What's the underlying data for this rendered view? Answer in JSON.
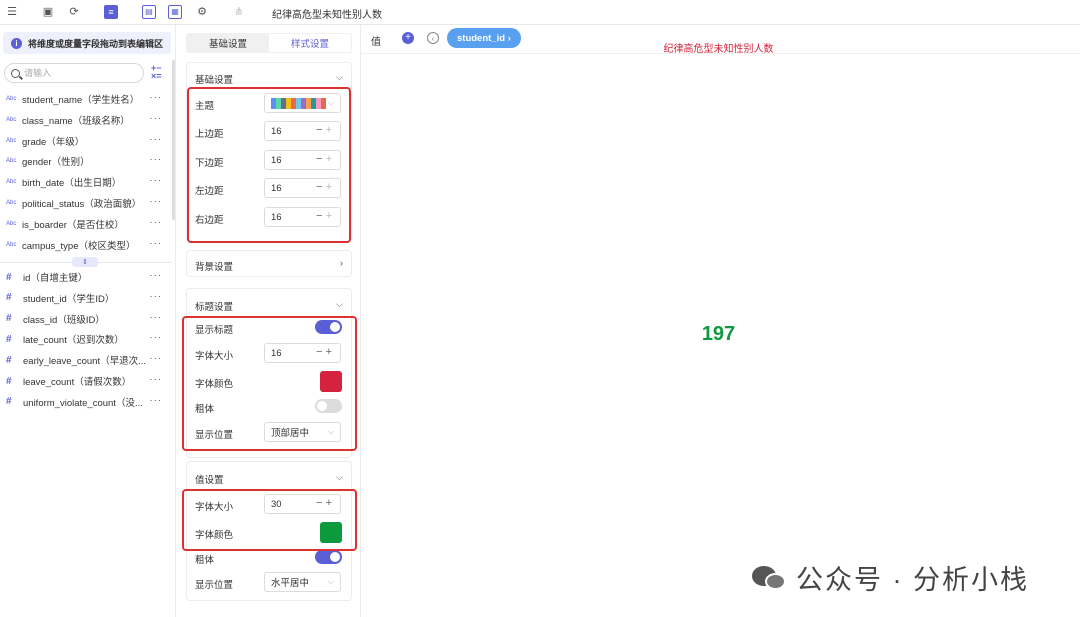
{
  "toolbar": {
    "title": "纪律高危型未知性别人数",
    "icons": [
      "menu-icon",
      "save-icon",
      "refresh-icon",
      "dataset-icon",
      "chart-config-icon",
      "layout-icon",
      "settings-icon",
      "share-icon"
    ]
  },
  "left_panel": {
    "hint": "将维度或度量字段拖动到表编辑区",
    "search_placeholder": "请输入",
    "dimension_type_label": "Abc",
    "measure_type_label": "#",
    "dimensions": [
      "student_name（学生姓名）",
      "class_name（班级名称）",
      "grade（年级）",
      "gender（性别）",
      "birth_date（出生日期）",
      "political_status（政治面貌）",
      "is_boarder（是否住校）",
      "campus_type（校区类型）"
    ],
    "measures": [
      "id（自增主键）",
      "student_id（学生ID）",
      "class_id（班级ID）",
      "late_count（迟到次数）",
      "early_leave_count（早退次...",
      "leave_count（请假次数）",
      "uniform_violate_count（没..."
    ],
    "more_label": "···"
  },
  "config": {
    "tabs": [
      "基础设置",
      "样式设置"
    ],
    "active_tab": 1,
    "basic": {
      "header": "基础设置",
      "theme_label": "主题",
      "theme_colors": [
        "#5b8ff9",
        "#5ad8a6",
        "#5d7092",
        "#f6bd16",
        "#e8684a",
        "#6dc8ec",
        "#9270ca",
        "#ff9d4d",
        "#269a99",
        "#ff99c3",
        "#e8684a"
      ],
      "margin_top_label": "上边距",
      "margin_top": "16",
      "margin_bottom_label": "下边距",
      "margin_bottom": "16",
      "margin_left_label": "左边距",
      "margin_left": "16",
      "margin_right_label": "右边距",
      "margin_right": "16"
    },
    "background": {
      "header": "背景设置"
    },
    "title": {
      "header": "标题设置",
      "show_title_label": "显示标题",
      "show_title": true,
      "font_size_label": "字体大小",
      "font_size": "16",
      "font_color_label": "字体颜色",
      "font_color": "#d6233d",
      "bold_label": "粗体",
      "bold": false,
      "position_label": "显示位置",
      "position": "顶部居中"
    },
    "value": {
      "header": "值设置",
      "font_size_label": "字体大小",
      "font_size": "30",
      "font_color_label": "字体颜色",
      "font_color": "#0d9a3f",
      "bold_label": "粗体",
      "bold": true,
      "position_label": "显示位置",
      "position": "水平居中"
    }
  },
  "canvas": {
    "value_label": "值",
    "field_pill": "student_id ›",
    "chart_title": "纪律高危型未知性别人数",
    "kpi_value": "197",
    "watermark": "公众号 · 分析小栈"
  }
}
